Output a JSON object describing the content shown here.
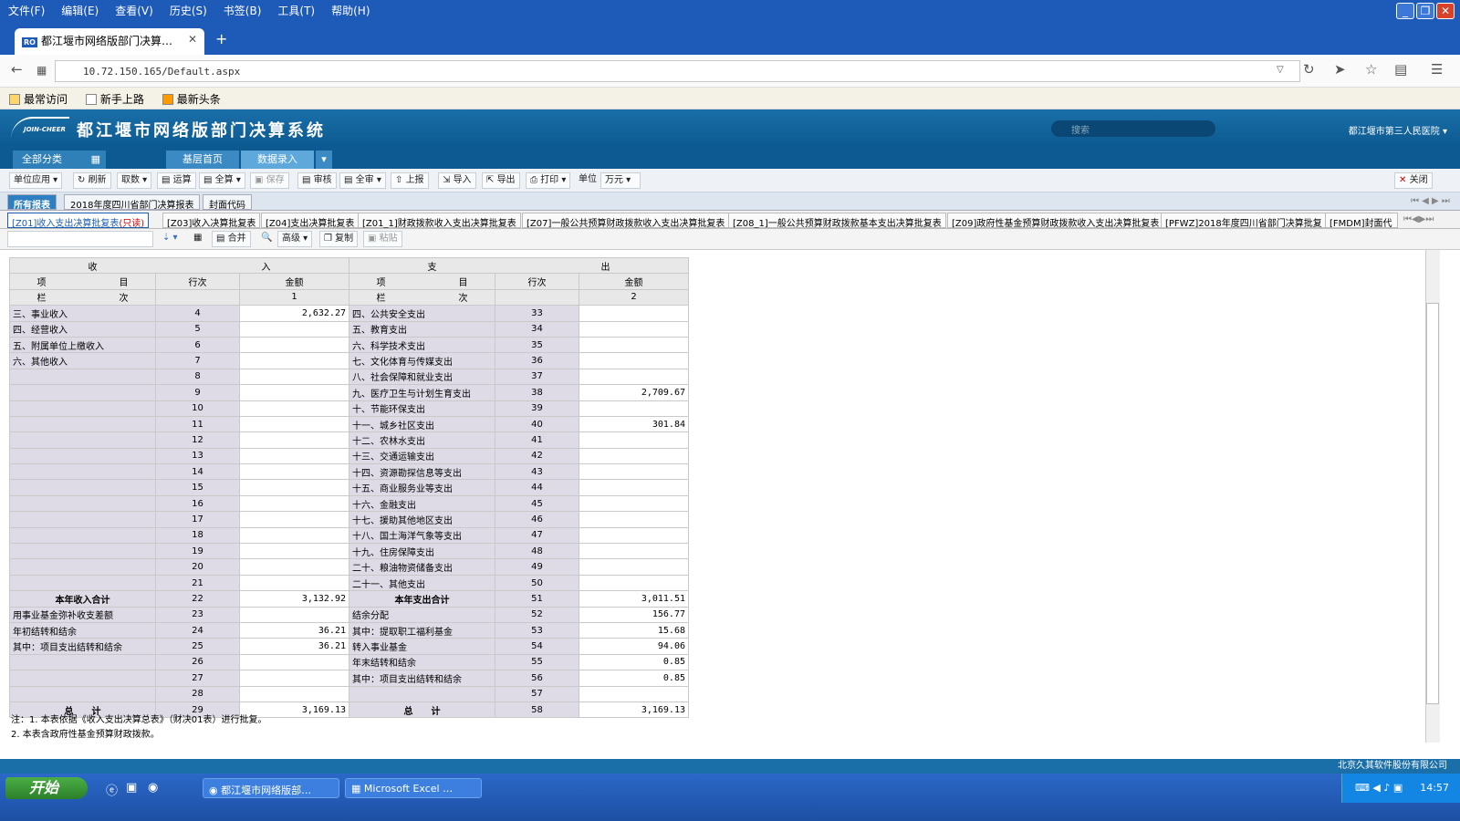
{
  "browser": {
    "menu": [
      "文件(F)",
      "编辑(E)",
      "查看(V)",
      "历史(S)",
      "书签(B)",
      "工具(T)",
      "帮助(H)"
    ],
    "tab_title": "都江堰市网络版部门决算…",
    "favicon": "RO",
    "url": "10.72.150.165/Default.aspx",
    "bookmarks": [
      "最常访问",
      "新手上路",
      "最新头条"
    ]
  },
  "app": {
    "logo": "JOIN-CHEER",
    "title": "都江堰市网络版部门决算系统",
    "search_placeholder": "搜索",
    "user": "都江堰市第三人民医院",
    "nav": {
      "all": "全部分类",
      "home": "基层首页",
      "entry": "数据录入"
    },
    "toolbar": [
      "单位应用",
      "刷新",
      "取数",
      "运算",
      "全算",
      "保存",
      "审核",
      "全审",
      "上报",
      "导入",
      "导出",
      "打印"
    ],
    "unit_label": "单位",
    "unit_value": "万元",
    "close_label": "关闭",
    "tabs2": [
      "所有报表",
      "2018年度四川省部门决算报表",
      "封面代码"
    ],
    "report_tabs": [
      "[Z01]收入支出决算批复表",
      "[Z03]收入决算批复表",
      "[Z04]支出决算批复表",
      "[Z01_1]财政拨款收入支出决算批复表",
      "[Z07]一般公共预算财政拨款收入支出决算批复表",
      "[Z08_1]一般公共预算财政拨款基本支出决算批复表",
      "[Z09]政府性基金预算财政拨款收入支出决算批复表",
      "[PFWZ]2018年度四川省部门决算批复",
      "[FMDM]封面代"
    ],
    "readonly_tag": "(只读)",
    "toolbar2": [
      "合并",
      "查找",
      "高级",
      "复制",
      "粘贴"
    ]
  },
  "grid": {
    "head_income": [
      "收",
      "入"
    ],
    "head_expense": [
      "支",
      "出"
    ],
    "cols": [
      "项",
      "目",
      "行次",
      "金额"
    ],
    "col_idx_label": [
      "栏",
      "次"
    ],
    "col_idx": [
      "1",
      "2"
    ],
    "rows": [
      [
        "三、事业收入",
        "4",
        "2,632.27",
        "四、公共安全支出",
        "33",
        ""
      ],
      [
        "四、经营收入",
        "5",
        "",
        "五、教育支出",
        "34",
        ""
      ],
      [
        "五、附属单位上缴收入",
        "6",
        "",
        "六、科学技术支出",
        "35",
        ""
      ],
      [
        "六、其他收入",
        "7",
        "",
        "七、文化体育与传媒支出",
        "36",
        ""
      ],
      [
        "",
        "8",
        "",
        "八、社会保障和就业支出",
        "37",
        ""
      ],
      [
        "",
        "9",
        "",
        "九、医疗卫生与计划生育支出",
        "38",
        "2,709.67"
      ],
      [
        "",
        "10",
        "",
        "十、节能环保支出",
        "39",
        ""
      ],
      [
        "",
        "11",
        "",
        "十一、城乡社区支出",
        "40",
        "301.84"
      ],
      [
        "",
        "12",
        "",
        "十二、农林水支出",
        "41",
        ""
      ],
      [
        "",
        "13",
        "",
        "十三、交通运输支出",
        "42",
        ""
      ],
      [
        "",
        "14",
        "",
        "十四、资源勘探信息等支出",
        "43",
        ""
      ],
      [
        "",
        "15",
        "",
        "十五、商业服务业等支出",
        "44",
        ""
      ],
      [
        "",
        "16",
        "",
        "十六、金融支出",
        "45",
        ""
      ],
      [
        "",
        "17",
        "",
        "十七、援助其他地区支出",
        "46",
        ""
      ],
      [
        "",
        "18",
        "",
        "十八、国土海洋气象等支出",
        "47",
        ""
      ],
      [
        "",
        "19",
        "",
        "十九、住房保障支出",
        "48",
        ""
      ],
      [
        "",
        "20",
        "",
        "二十、粮油物资储备支出",
        "49",
        ""
      ],
      [
        "",
        "21",
        "",
        "二十一、其他支出",
        "50",
        ""
      ],
      [
        "本年收入合计",
        "22",
        "3,132.92",
        "本年支出合计",
        "51",
        "3,011.51"
      ],
      [
        "用事业基金弥补收支差额",
        "23",
        "",
        "结余分配",
        "52",
        "156.77"
      ],
      [
        "年初结转和结余",
        "24",
        "36.21",
        "  其中：提取职工福利基金",
        "53",
        "15.68"
      ],
      [
        "  其中：项目支出结转和结余",
        "25",
        "36.21",
        "        转入事业基金",
        "54",
        "94.06"
      ],
      [
        "",
        "26",
        "",
        "年末结转和结余",
        "55",
        "0.85"
      ],
      [
        "",
        "27",
        "",
        "  其中：项目支出结转和结余",
        "56",
        "0.85"
      ],
      [
        "",
        "28",
        "",
        "",
        "57",
        ""
      ],
      [
        "总　　计",
        "29",
        "3,169.13",
        "总　　计",
        "58",
        "3,169.13"
      ]
    ],
    "notes": [
      "注：1. 本表依据《收入支出决算总表》（财决01表）进行批复。",
      "    2. 本表含政府性基金预算财政拨款。"
    ]
  },
  "status": "北京久其软件股份有限公司",
  "taskbar": {
    "start": "开始",
    "tasks": [
      "都江堰市网络版部…",
      "Microsoft Excel …"
    ],
    "clock": "14:57"
  }
}
